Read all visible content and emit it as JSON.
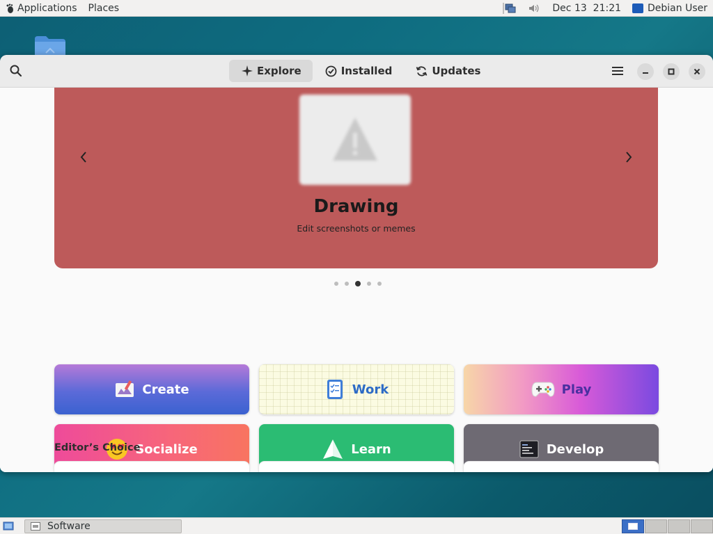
{
  "top_panel": {
    "applications_label": "Applications",
    "places_label": "Places",
    "datetime": "Dec 13  21:21",
    "user_name": "Debian User"
  },
  "window": {
    "tabs": [
      {
        "label": "Explore",
        "icon": "explore-sparkle-icon",
        "active": true
      },
      {
        "label": "Installed",
        "icon": "checkmark-circle-icon",
        "active": false
      },
      {
        "label": "Updates",
        "icon": "refresh-icon",
        "active": false
      }
    ]
  },
  "banner": {
    "title": "Drawing",
    "subtitle": "Edit screenshots or memes",
    "color": "#bd5a5a",
    "page_count": 5,
    "active_page": 3
  },
  "categories": [
    {
      "label": "Create",
      "icon": "create-icon"
    },
    {
      "label": "Work",
      "icon": "work-checklist-icon"
    },
    {
      "label": "Play",
      "icon": "gamepad-icon"
    },
    {
      "label": "Socialize",
      "icon": "smiley-heart-eyes-icon"
    },
    {
      "label": "Learn",
      "icon": "learn-sail-icon"
    },
    {
      "label": "Develop",
      "icon": "terminal-icon"
    }
  ],
  "section": {
    "editors_choice": "Editor’s Choice"
  },
  "bottom_panel": {
    "task_label": "Software"
  }
}
